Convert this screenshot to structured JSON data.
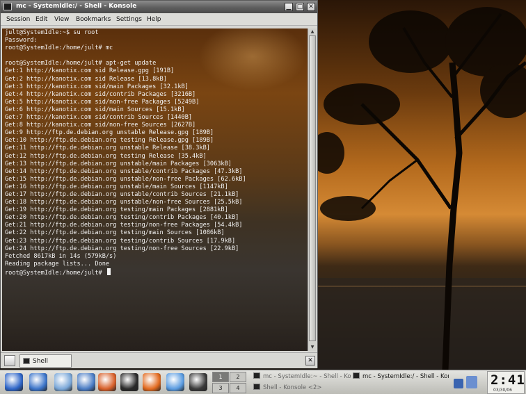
{
  "window": {
    "title": "mc - SystemIdle:/ - Shell - Konsole",
    "minimize_glyph": "▁",
    "maximize_glyph": "□",
    "close_glyph": "✕"
  },
  "menubar": {
    "items": [
      "Session",
      "Edit",
      "View",
      "Bookmarks",
      "Settings",
      "Help"
    ]
  },
  "terminal": {
    "lines": [
      "jult@SystemIdle:~$ su root",
      "Password:",
      "root@SystemIdle:/home/jult# mc",
      "",
      "root@SystemIdle:/home/jult# apt-get update",
      "Get:1 http://kanotix.com sid Release.gpg [191B]",
      "Get:2 http://kanotix.com sid Release [13.8kB]",
      "Get:3 http://kanotix.com sid/main Packages [32.1kB]",
      "Get:4 http://kanotix.com sid/contrib Packages [3216B]",
      "Get:5 http://kanotix.com sid/non-free Packages [5249B]",
      "Get:6 http://kanotix.com sid/main Sources [15.1kB]",
      "Get:7 http://kanotix.com sid/contrib Sources [1440B]",
      "Get:8 http://kanotix.com sid/non-free Sources [2627B]",
      "Get:9 http://ftp.de.debian.org unstable Release.gpg [189B]",
      "Get:10 http://ftp.de.debian.org testing Release.gpg [189B]",
      "Get:11 http://ftp.de.debian.org unstable Release [38.3kB]",
      "Get:12 http://ftp.de.debian.org testing Release [35.4kB]",
      "Get:13 http://ftp.de.debian.org unstable/main Packages [3063kB]",
      "Get:14 http://ftp.de.debian.org unstable/contrib Packages [47.3kB]",
      "Get:15 http://ftp.de.debian.org unstable/non-free Packages [62.6kB]",
      "Get:16 http://ftp.de.debian.org unstable/main Sources [1147kB]",
      "Get:17 http://ftp.de.debian.org unstable/contrib Sources [21.1kB]",
      "Get:18 http://ftp.de.debian.org unstable/non-free Sources [25.5kB]",
      "Get:19 http://ftp.de.debian.org testing/main Packages [2881kB]",
      "Get:20 http://ftp.de.debian.org testing/contrib Packages [40.1kB]",
      "Get:21 http://ftp.de.debian.org testing/non-free Packages [54.4kB]",
      "Get:22 http://ftp.de.debian.org testing/main Sources [1086kB]",
      "Get:23 http://ftp.de.debian.org testing/contrib Sources [17.9kB]",
      "Get:24 http://ftp.de.debian.org testing/non-free Sources [22.9kB]",
      "Fetched 8617kB in 14s (579kB/s)",
      "Reading package lists... Done",
      "root@SystemIdle:/home/jult# "
    ]
  },
  "tabs": [
    {
      "label": "Shell",
      "icon": "terminal-icon"
    }
  ],
  "taskbar": {
    "launchers": [
      {
        "name": "kde-menu-icon",
        "color": "#2f66c8"
      },
      {
        "name": "web-browser-icon",
        "color": "#3b74c9"
      },
      {
        "name": "file-manager-icon",
        "color": "#7aa7d8"
      },
      {
        "name": "kmail-icon",
        "color": "#4a7cc4"
      },
      {
        "name": "home-folder-icon",
        "color": "#d7602a"
      },
      {
        "name": "konsole-icon",
        "color": "#2a2a2a"
      },
      {
        "name": "firefox-icon",
        "color": "#e26a1f"
      },
      {
        "name": "kdict-icon",
        "color": "#5a9be0"
      },
      {
        "name": "kwrite-icon",
        "color": "#3a3a3a"
      }
    ],
    "pager": [
      "1",
      "2",
      "3",
      "4"
    ],
    "tasks": [
      {
        "label": "mc - SystemIdle:~ - Shell - Konsole",
        "active": false
      },
      {
        "label": "mc - SystemIdle:/ - Shell - Konsole",
        "active": true
      },
      {
        "label": "Shell - Konsole <2>",
        "active": false
      }
    ],
    "clock": {
      "time": "2:41",
      "date": "03/30/06"
    }
  }
}
